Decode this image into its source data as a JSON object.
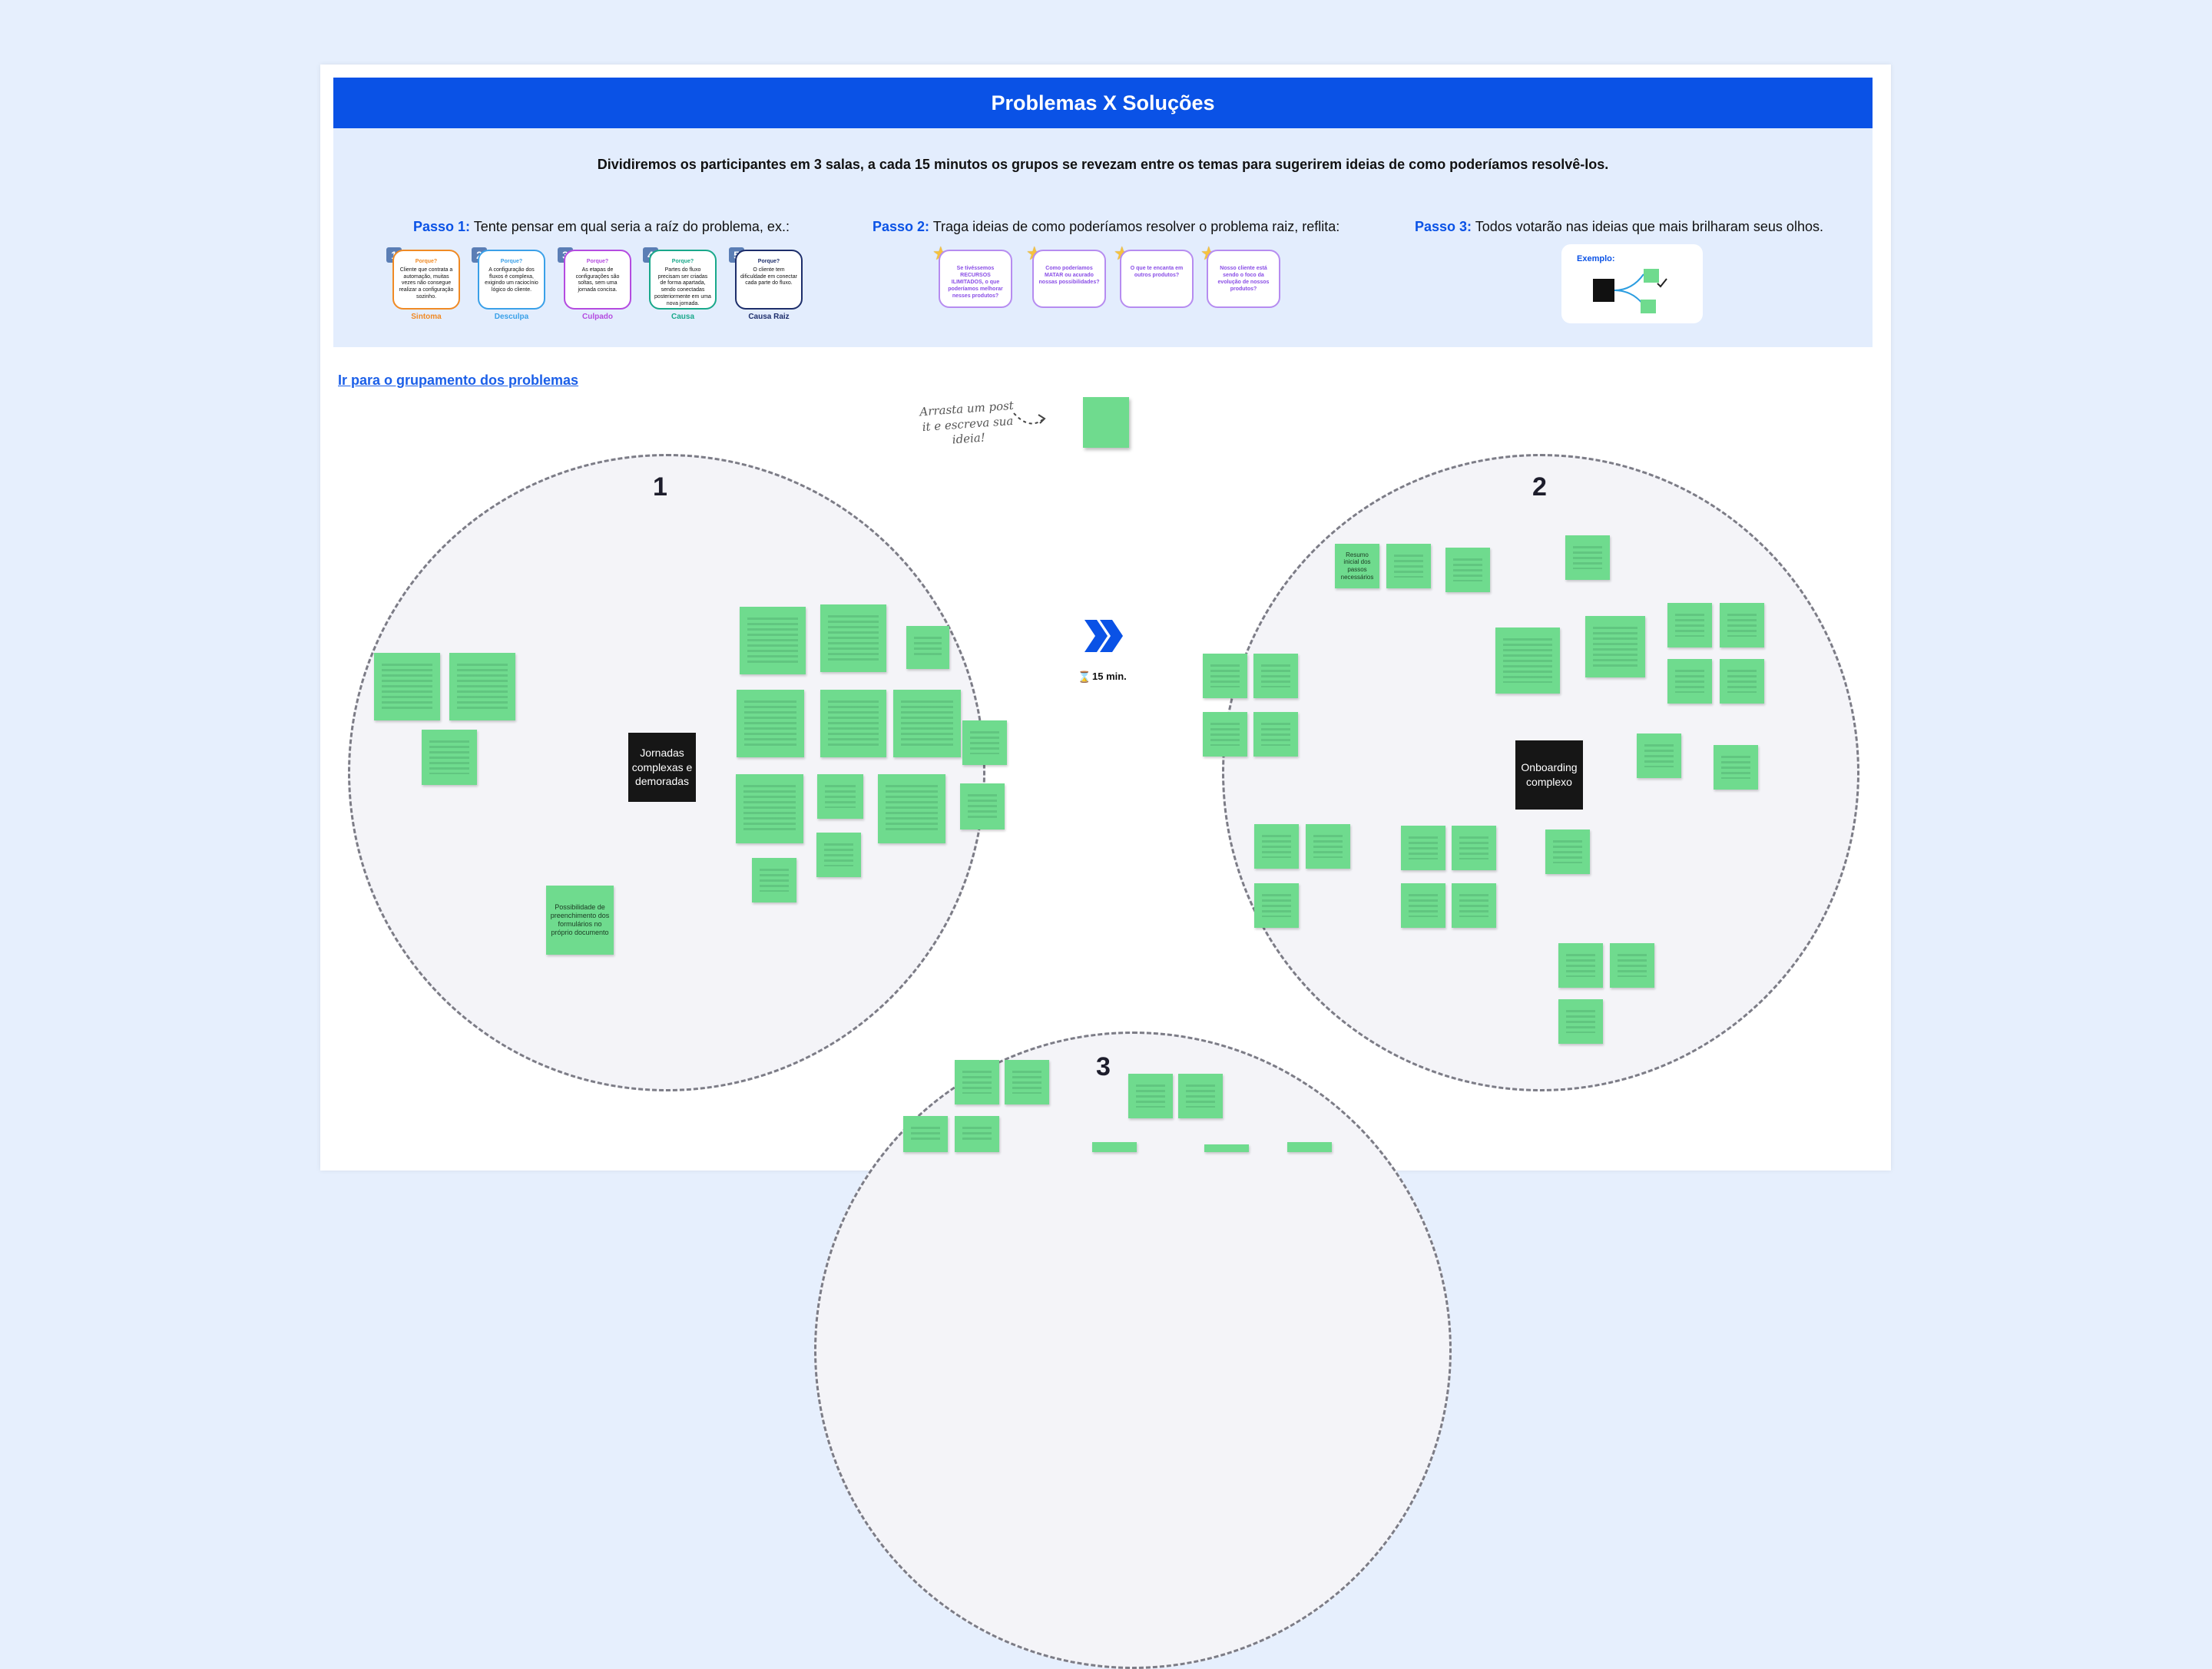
{
  "title": "Problemas X Soluções",
  "intro": "Dividiremos os participantes em 3 salas,  a cada 15 minutos os grupos se revezam entre os temas para sugerirem ideias de como poderíamos resolvê-los.",
  "steps": [
    {
      "label": "Passo 1:",
      "text": " Tente pensar em qual seria a raíz do problema, ex.:"
    },
    {
      "label": "Passo 2:",
      "text": " Traga ideias de como poderíamos resolver o problema raiz, reflita:"
    },
    {
      "label": "Passo 3:",
      "text": " Todos votarão nas ideias que mais brilharam seus olhos."
    }
  ],
  "cause_cards": [
    {
      "num": "1",
      "q": "Porque?",
      "text": "Cliente que contrata a automação, muitas vezes não consegue realizar a configuração sozinho.",
      "label": "Sintoma",
      "color": "#f08a24"
    },
    {
      "num": "2",
      "q": "Porque?",
      "text": "A configuração dos fluxos é complexa, exigindo um raciocínio lógico do cliente.",
      "label": "Desculpa",
      "color": "#3aa0e8"
    },
    {
      "num": "3",
      "q": "Porque?",
      "text": "As etapas de configurações são soltas, sem uma jornada concisa.",
      "label": "Culpado",
      "color": "#b44be0"
    },
    {
      "num": "4",
      "q": "Porque?",
      "text": "Partes do fluxo precisam ser criadas de forma apartada, sendo conectadas posteriormente em uma nova jornada.",
      "label": "Causa",
      "color": "#19a88a"
    },
    {
      "num": "5",
      "q": "Porque?",
      "text": "O cliente tem dificuldade em conectar cada parte do fluxo.",
      "label": "Causa Raiz",
      "color": "#1d2e6b"
    }
  ],
  "idea_cards": [
    "Se tivéssemos RECURSOS ILIMITADOS, o que poderíamos melhorar nesses produtos?",
    "Como poderíamos MATAR ou acurado nossas possibilidades?",
    "O que te encanta em outros produtos?",
    "Nosso cliente está sendo o foco da evolução de nossos produtos?"
  ],
  "example_label": "Exemplo:",
  "link_text": "Ir para o grupamento dos problemas",
  "hint_text": "Arrasta um post it e escreva sua ideia!",
  "timer_text": "15 min.",
  "rooms": [
    {
      "number": "1",
      "topic": "Jornadas complexas e demoradas"
    },
    {
      "number": "2",
      "topic": "Onboarding complexo"
    },
    {
      "number": "3",
      "topic": ""
    }
  ],
  "readable_notes": [
    "Resumo inicial dos passos necessários",
    "Possibilidade de preenchimento dos formulários no próprio documento"
  ],
  "colors": {
    "brand": "#0a52e6",
    "header_panel": "#e3edfd",
    "postit": "#6fdb8e",
    "topic_card": "#161616"
  },
  "icons": [
    "star-icon",
    "double-chevron-right-icon",
    "hourglass-icon",
    "mind-map-icon"
  ]
}
